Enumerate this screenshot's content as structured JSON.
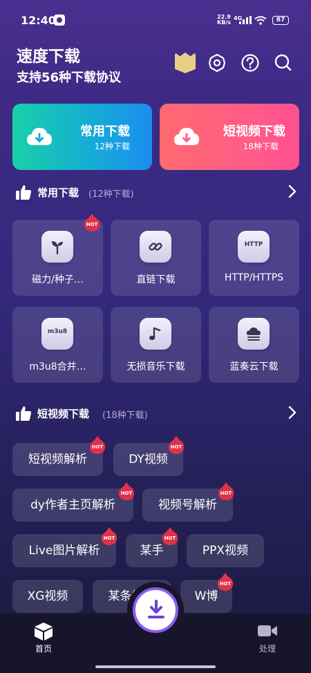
{
  "status_bar": {
    "time": "12:40",
    "net_speed_value": "22.9",
    "net_speed_unit": "KB/s",
    "network": "4G",
    "battery": "87"
  },
  "header": {
    "title": "速度下载",
    "subtitle": "支持56种下载协议",
    "icons": [
      "crown-badge-icon",
      "settings-icon",
      "help-icon",
      "search-icon"
    ]
  },
  "cards": {
    "common": {
      "title": "常用下载",
      "sub": "12种下载"
    },
    "short": {
      "title": "短视频下载",
      "sub": "18种下载"
    }
  },
  "section_common": {
    "title": "常用下载",
    "count": "(12种下载)"
  },
  "tiles": [
    {
      "label": "磁力/种子…",
      "icon": "sprout-icon",
      "hot": true
    },
    {
      "label": "直链下载",
      "icon": "link-icon",
      "hot": false
    },
    {
      "label": "HTTP/HTTPS",
      "icon": "http-icon",
      "icon_text": "HTTP",
      "hot": false
    },
    {
      "label": "m3u8合并…",
      "icon": "m3u8-icon",
      "icon_text": "m3u8",
      "hot": false
    },
    {
      "label": "无损音乐下载",
      "icon": "music-note-icon",
      "hot": false
    },
    {
      "label": "蓝奏云下载",
      "icon": "cloud-stack-icon",
      "hot": false
    }
  ],
  "section_short": {
    "title": "短视频下载",
    "count": "(18种下载)"
  },
  "pills": [
    {
      "label": "短视频解析",
      "hot": true
    },
    {
      "label": "DY视频",
      "hot": true
    },
    {
      "label": "dy作者主页解析",
      "hot": true
    },
    {
      "label": "视频号解析",
      "hot": true
    },
    {
      "label": "Live图片解析",
      "hot": true
    },
    {
      "label": "某手",
      "hot": true
    },
    {
      "label": "PPX视频",
      "hot": false
    },
    {
      "label": "XG视频",
      "hot": false
    },
    {
      "label": "某条视频",
      "hot": false
    },
    {
      "label": "W博",
      "hot": true
    }
  ],
  "hot_label": "HOT",
  "bottom_nav": {
    "home": "首页",
    "process": "处理"
  },
  "colors": {
    "bg_top": "#4a2f8f",
    "bg_bottom": "#1a183d",
    "card_common": "#16a9d8",
    "card_short": "#ff5d86",
    "hot": "#e0314a",
    "fab_ring": "#8b5cf0"
  }
}
